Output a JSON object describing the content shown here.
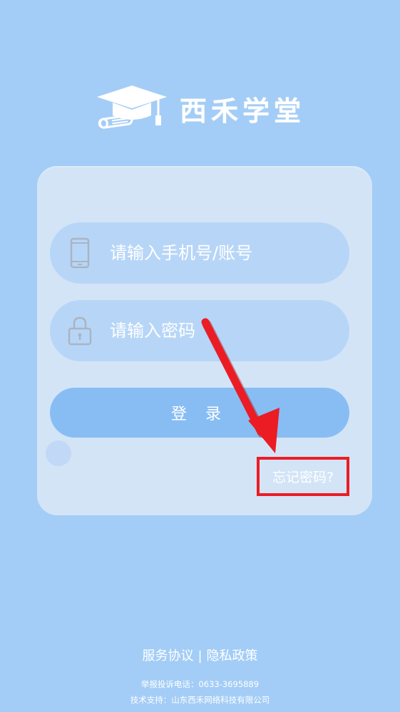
{
  "app": {
    "brand_name": "西禾学堂"
  },
  "login": {
    "account_placeholder": "请输入手机号/账号",
    "password_placeholder": "请输入密码",
    "login_label": "登 录",
    "forgot_label": "忘记密码?"
  },
  "icons": {
    "account": "phone-icon",
    "password": "lock-icon",
    "logo": "graduation-cap-icon"
  },
  "footer": {
    "service_agreement": "服务协议",
    "separator": "|",
    "privacy_policy": "隐私政策",
    "hotline": "举报投诉电话：0633-3695889",
    "support": "技术支持：山东西禾网络科技有限公司"
  },
  "colors": {
    "background": "#a3cdf6",
    "card": "#d3e4f7",
    "field": "#b7d6f7",
    "button": "#88bdf4",
    "highlight": "#ec1c24"
  }
}
